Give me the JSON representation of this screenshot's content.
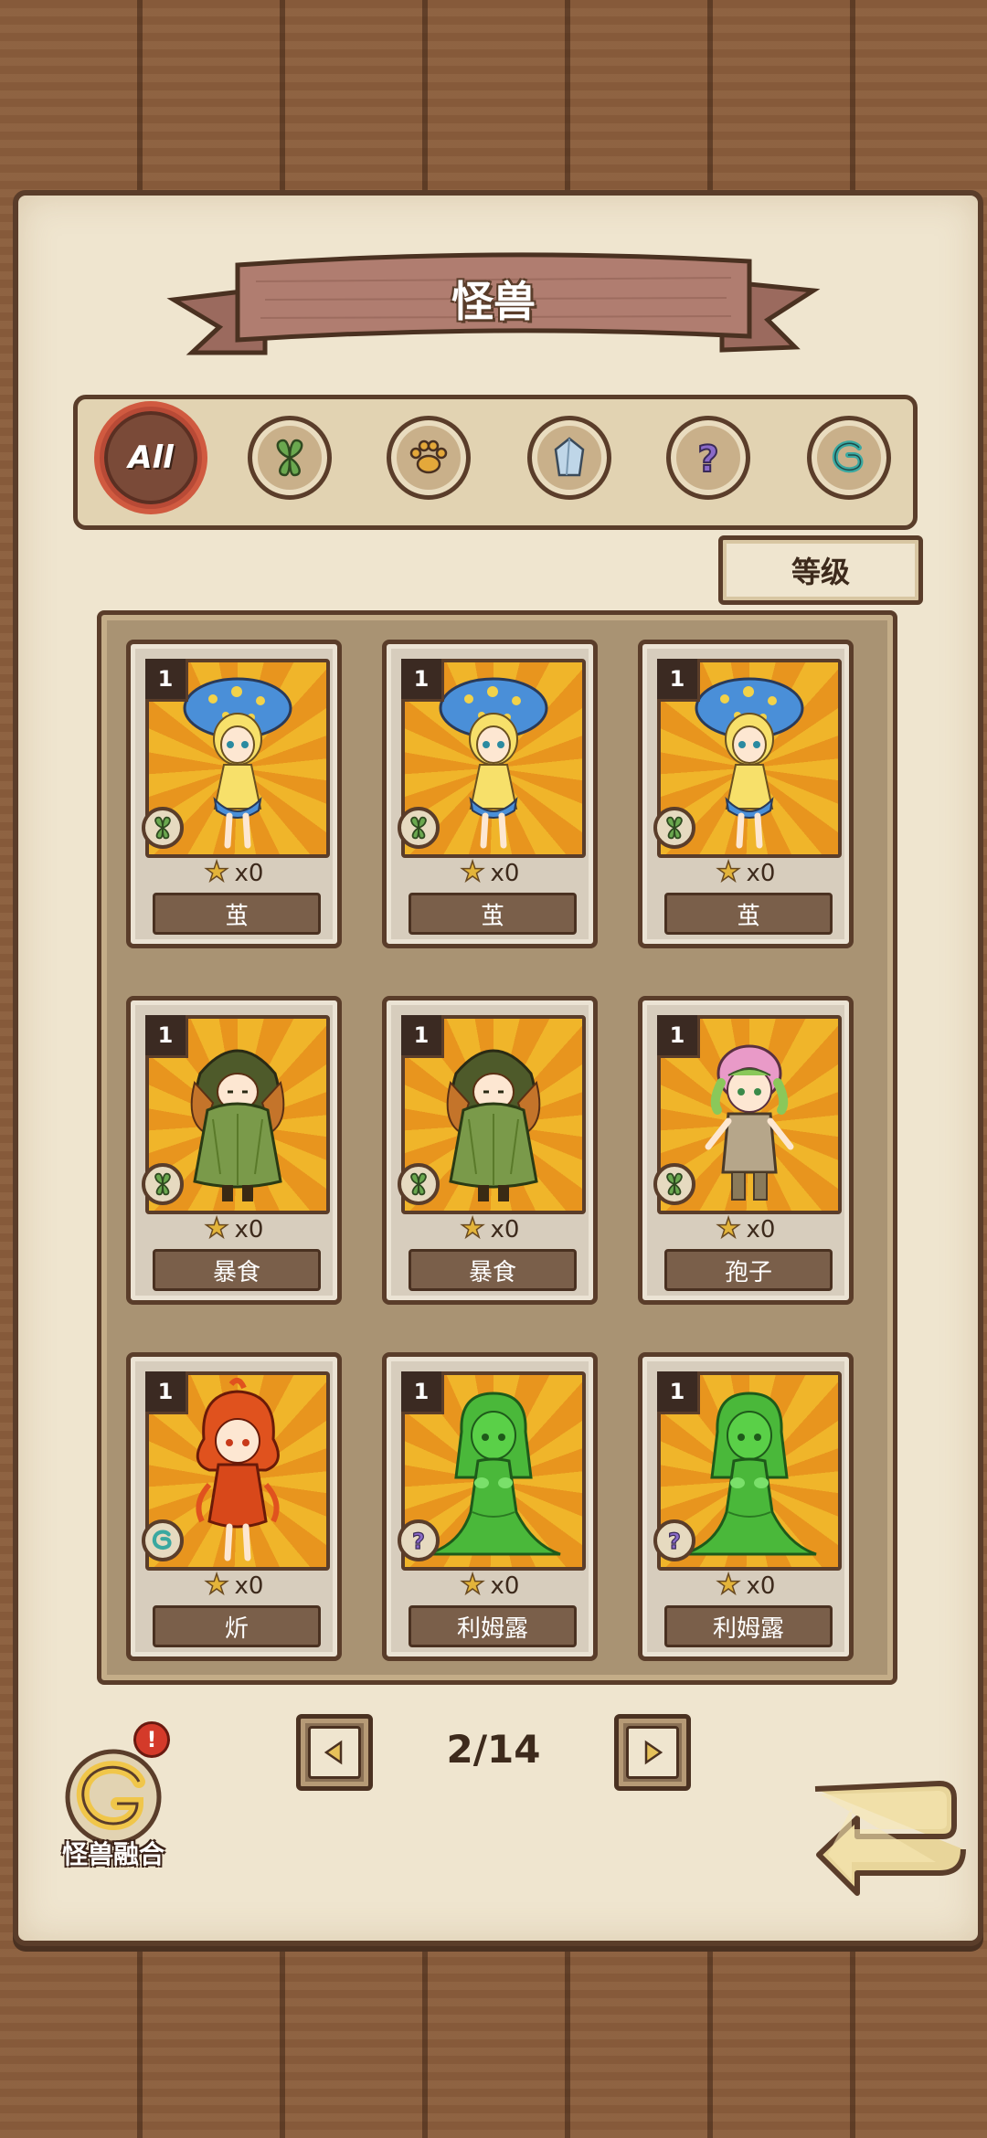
{
  "header": {
    "title": "怪兽"
  },
  "filters": [
    {
      "id": "all",
      "label": "All",
      "icon": "all-icon",
      "active": true
    },
    {
      "id": "plant",
      "icon": "leaf-icon",
      "active": false
    },
    {
      "id": "beast",
      "icon": "paw-icon",
      "active": false
    },
    {
      "id": "mineral",
      "icon": "crystal-icon",
      "active": false
    },
    {
      "id": "unknown",
      "icon": "question-icon",
      "active": false
    },
    {
      "id": "element",
      "icon": "swirl-icon",
      "active": false
    }
  ],
  "sort": {
    "label": "等级"
  },
  "cards": [
    {
      "level": "1",
      "stars": "x0",
      "name": "茧",
      "type_icon": "leaf-icon",
      "character": "mushroom-girl"
    },
    {
      "level": "1",
      "stars": "x0",
      "name": "茧",
      "type_icon": "leaf-icon",
      "character": "mushroom-girl"
    },
    {
      "level": "1",
      "stars": "x0",
      "name": "茧",
      "type_icon": "leaf-icon",
      "character": "mushroom-girl"
    },
    {
      "level": "1",
      "stars": "x0",
      "name": "暴食",
      "type_icon": "leaf-icon",
      "character": "moss-cloak"
    },
    {
      "level": "1",
      "stars": "x0",
      "name": "暴食",
      "type_icon": "leaf-icon",
      "character": "moss-cloak"
    },
    {
      "level": "1",
      "stars": "x0",
      "name": "孢子",
      "type_icon": "leaf-icon",
      "character": "spore-girl"
    },
    {
      "level": "1",
      "stars": "x0",
      "name": "炘",
      "type_icon": "swirl-icon",
      "character": "fire-girl"
    },
    {
      "level": "1",
      "stars": "x0",
      "name": "利姆露",
      "type_icon": "question-icon",
      "character": "slime-girl"
    },
    {
      "level": "1",
      "stars": "x0",
      "name": "利姆露",
      "type_icon": "question-icon",
      "character": "slime-girl"
    }
  ],
  "pager": {
    "indicator": "2/14",
    "prev_icon": "arrow-left-icon",
    "next_icon": "arrow-right-icon"
  },
  "fusion": {
    "label": "怪兽融合",
    "alert": "!"
  },
  "back": {
    "icon": "return-arrow-icon"
  },
  "colors": {
    "wood": "#8b5e3c",
    "parchment": "#efe5cf",
    "ink": "#5a3d2a",
    "accent_red": "#d05a40",
    "card_bg": "#f0b52a"
  }
}
